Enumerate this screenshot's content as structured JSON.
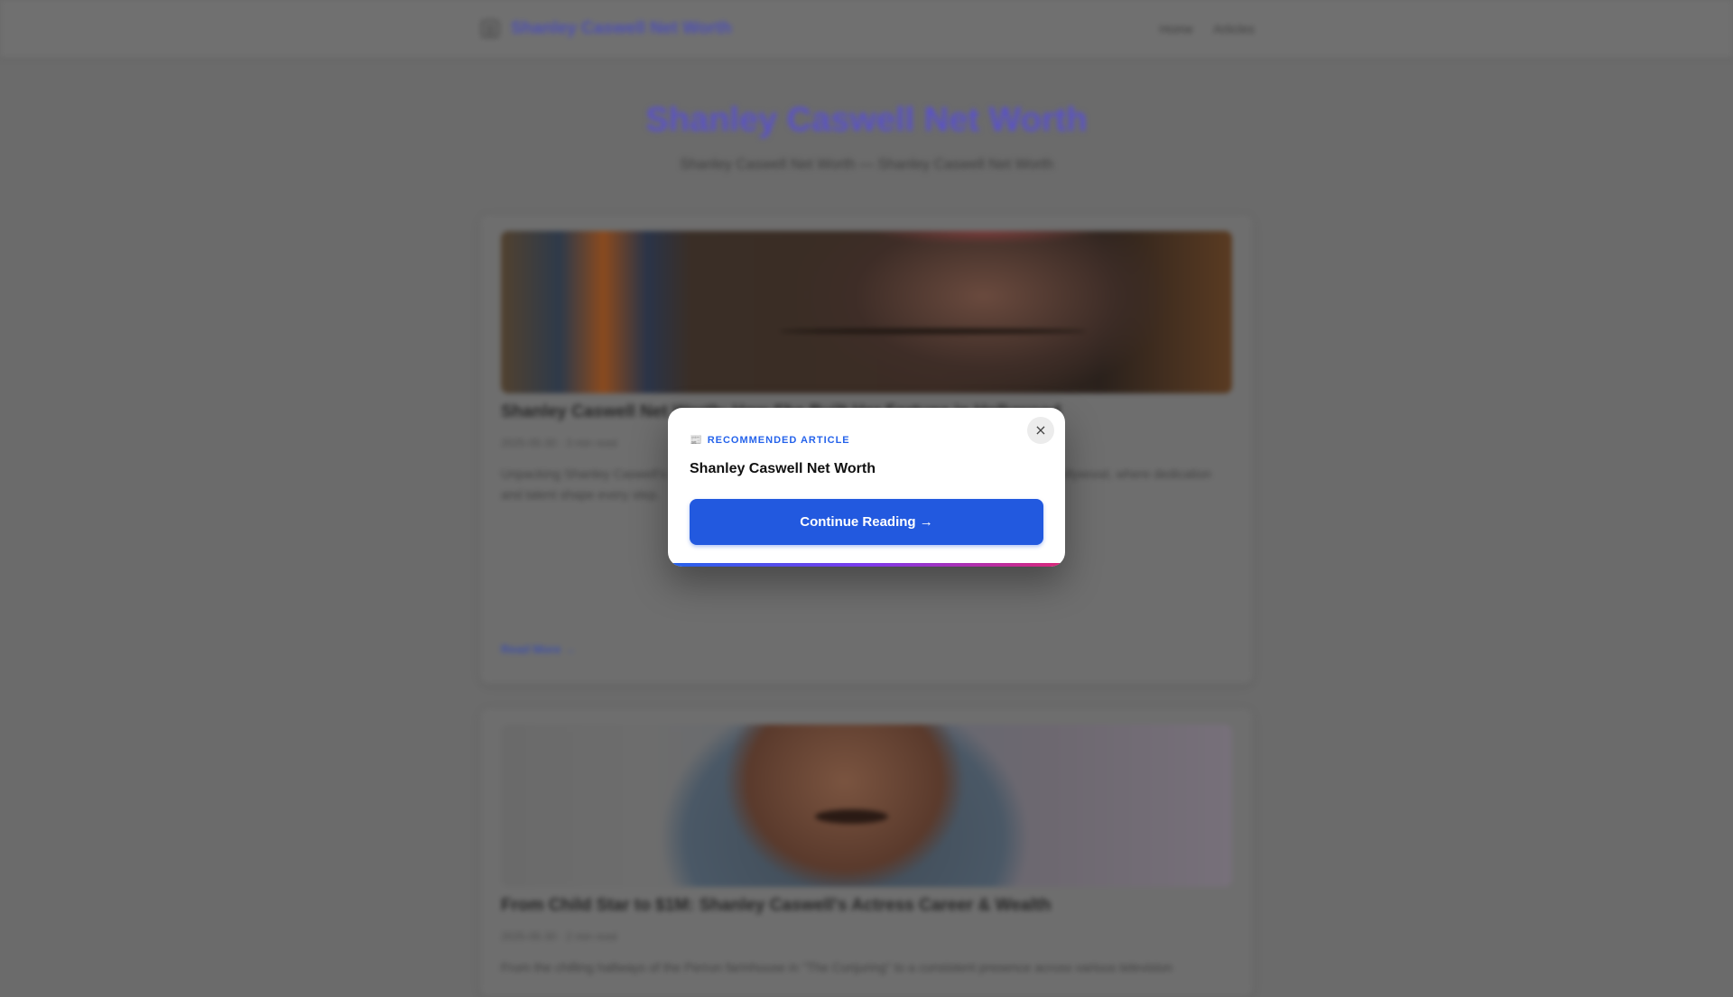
{
  "header": {
    "site_name": "Shanley Caswell Net Worth",
    "nav": [
      "Home",
      "Articles"
    ]
  },
  "hero": {
    "title": "Shanley Caswell Net Worth",
    "subtitle": "Shanley Caswell Net Worth — Shanley Caswell Net Worth"
  },
  "articles": [
    {
      "title": "Shanley Caswell Net Worth: How She Built Her Fortune in Hollywood",
      "meta": "2025-05-30 · 3 min read",
      "excerpt": "Unpacking Shanley Caswell's net worth means looking at a career built in the competitive world of Hollywood, where dedication and talent shape every step.",
      "read_more": "Read More →"
    },
    {
      "title": "From Child Star to $1M: Shanley Caswell's Actress Career & Wealth",
      "meta": "2025-05-30 · 2 min read",
      "excerpt": "From the chilling hallways of the Perron farmhouse in \"The Conjuring\" to a consistent presence across various television",
      "read_more": "Read More →"
    }
  ],
  "modal": {
    "kicker_icon": "newspaper-icon",
    "kicker": "RECOMMENDED ARTICLE",
    "title": "Shanley Caswell Net Worth",
    "cta": "Continue Reading →",
    "close": "×"
  },
  "colors": {
    "accent": "#2259df",
    "overlay": "#6b6b6b",
    "modal_bg": "#ffffff",
    "gradient": [
      "#2563eb",
      "#7c3aed",
      "#db2777"
    ]
  }
}
